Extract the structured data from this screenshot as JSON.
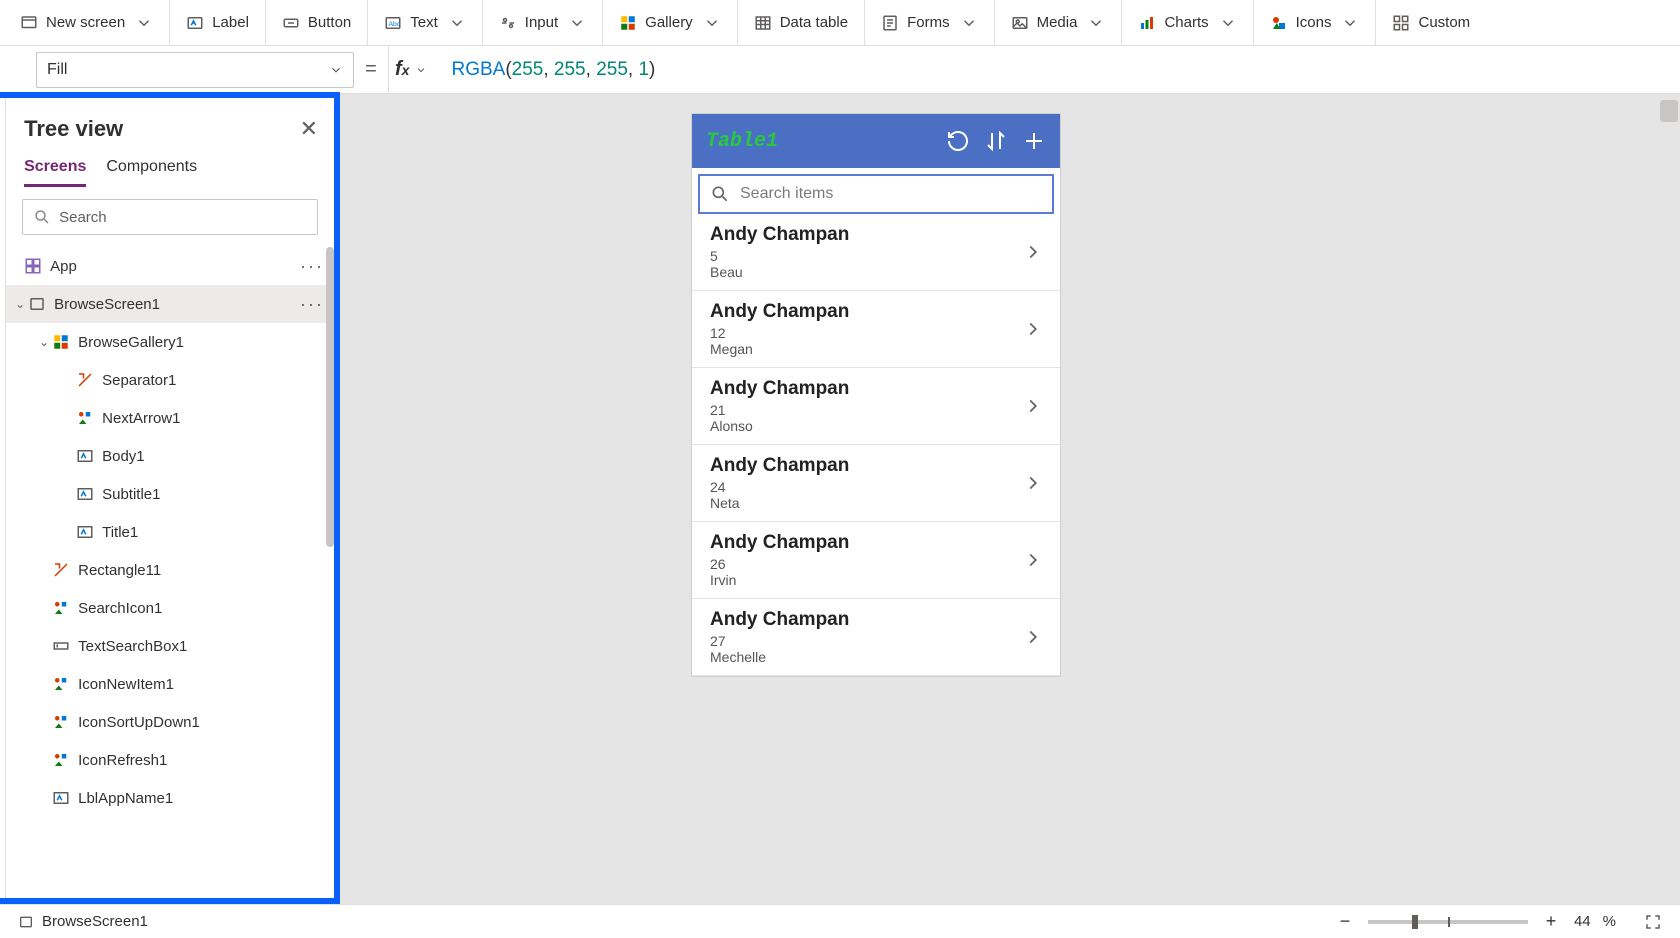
{
  "toolbar": {
    "new_screen": "New screen",
    "label": "Label",
    "button": "Button",
    "text": "Text",
    "input": "Input",
    "gallery": "Gallery",
    "data_table": "Data table",
    "forms": "Forms",
    "media": "Media",
    "charts": "Charts",
    "icons": "Icons",
    "custom": "Custom"
  },
  "property_selector": "Fill",
  "formula": {
    "fn": "RGBA",
    "args": [
      "255",
      "255",
      "255",
      "1"
    ]
  },
  "tree_view": {
    "title": "Tree view",
    "tabs": {
      "screens": "Screens",
      "components": "Components"
    },
    "search_placeholder": "Search",
    "nodes": {
      "app": "App",
      "browse_screen": "BrowseScreen1",
      "browse_gallery": "BrowseGallery1",
      "separator": "Separator1",
      "next_arrow": "NextArrow1",
      "body": "Body1",
      "subtitle": "Subtitle1",
      "title": "Title1",
      "rectangle": "Rectangle11",
      "search_icon": "SearchIcon1",
      "text_search_box": "TextSearchBox1",
      "icon_new_item": "IconNewItem1",
      "icon_sort": "IconSortUpDown1",
      "icon_refresh": "IconRefresh1",
      "lbl_app_name": "LblAppName1"
    }
  },
  "phone": {
    "title": "Table1",
    "search_placeholder": "Search items",
    "items": [
      {
        "name": "Andy Champan",
        "num": "5",
        "sub": "Beau"
      },
      {
        "name": "Andy Champan",
        "num": "12",
        "sub": "Megan"
      },
      {
        "name": "Andy Champan",
        "num": "21",
        "sub": "Alonso"
      },
      {
        "name": "Andy Champan",
        "num": "24",
        "sub": "Neta"
      },
      {
        "name": "Andy Champan",
        "num": "26",
        "sub": "Irvin"
      },
      {
        "name": "Andy Champan",
        "num": "27",
        "sub": "Mechelle"
      }
    ]
  },
  "status": {
    "selection": "BrowseScreen1",
    "zoom_value": "44",
    "zoom_pct": "%"
  }
}
